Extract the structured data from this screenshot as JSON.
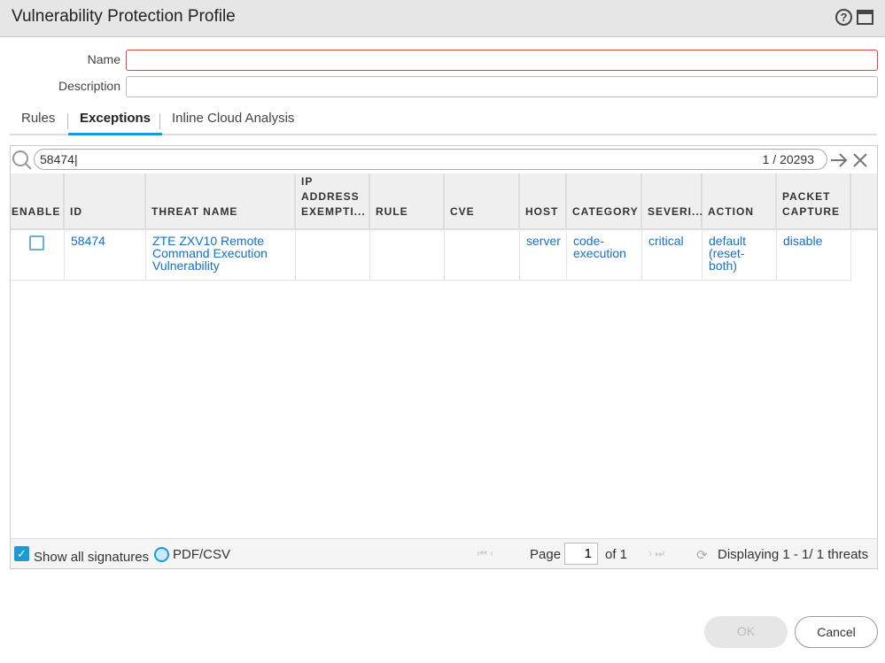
{
  "title": "Vulnerability Protection Profile",
  "form": {
    "name_label": "Name",
    "name_value": "",
    "description_label": "Description",
    "description_value": ""
  },
  "tabs": [
    "Rules",
    "Exceptions",
    "Inline Cloud Analysis"
  ],
  "search": {
    "value": "58474",
    "count": "1 / 20293"
  },
  "columns": [
    "ENABLE",
    "ID",
    "THREAT NAME",
    "IP ADDRESS EXEMPTI...",
    "RULE",
    "CVE",
    "HOST",
    "CATEGORY",
    "SEVERI...",
    "ACTION",
    "PACKET CAPTURE"
  ],
  "rows": [
    {
      "enable": false,
      "id": "58474",
      "threat_name": "ZTE ZXV10 Remote Command Execution Vulnerability",
      "ip": "",
      "rule": "",
      "cve": "",
      "host": "server",
      "category": "code-execution",
      "severity": "critical",
      "action": "default (reset-both)",
      "packet_capture": "disable"
    }
  ],
  "footer": {
    "show_all": "Show all signatures",
    "show_all_checked": true,
    "pdf": "PDF/CSV",
    "page_label": "Page",
    "page": "1",
    "of": "of 1",
    "display": "Displaying 1 - 1/ 1 threats"
  },
  "buttons": {
    "ok": "OK",
    "cancel": "Cancel"
  },
  "colors": {
    "accent": "#1a9bd7",
    "link": "#1670c7",
    "error": "#e0443a"
  }
}
